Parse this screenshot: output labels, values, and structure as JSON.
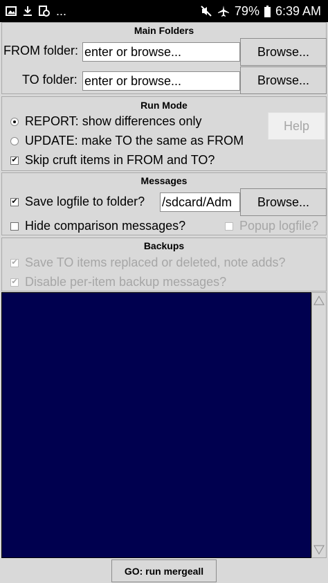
{
  "status_bar": {
    "more": "...",
    "battery": "79%",
    "time": "6:39 AM",
    "icons": [
      "image-icon",
      "download-icon",
      "screenshot-icon",
      "mute-icon",
      "airplane-icon",
      "battery-icon"
    ]
  },
  "main_folders": {
    "title": "Main Folders",
    "from_label": "FROM folder:",
    "from_value": "enter or browse...",
    "from_browse": "Browse...",
    "to_label": "TO folder:",
    "to_value": "enter or browse...",
    "to_browse": "Browse..."
  },
  "run_mode": {
    "title": "Run Mode",
    "report_label": "REPORT: show differences only",
    "report_selected": true,
    "update_label": "UPDATE: make TO the same as FROM",
    "update_selected": false,
    "skip_cruft_label": "Skip cruft items in FROM and TO?",
    "skip_cruft_checked": true,
    "help_label": "Help"
  },
  "messages": {
    "title": "Messages",
    "save_logfile_label": "Save logfile to folder?",
    "save_logfile_checked": true,
    "logfile_path": "/sdcard/Adm",
    "browse_label": "Browse...",
    "hide_comparison_label": "Hide comparison messages?",
    "hide_comparison_checked": false,
    "popup_logfile_label": "Popup logfile?",
    "popup_logfile_checked": false
  },
  "backups": {
    "title": "Backups",
    "save_to_items_label": "Save TO items replaced or deleted, note adds?",
    "save_to_items_checked": true,
    "disable_backup_msgs_label": "Disable per-item backup messages?",
    "disable_backup_msgs_checked": true
  },
  "go_button": "GO: run mergeall",
  "colors": {
    "log_background": "#00004f",
    "window_background": "#d9d9d9",
    "disabled_text": "#a6a6a6"
  }
}
